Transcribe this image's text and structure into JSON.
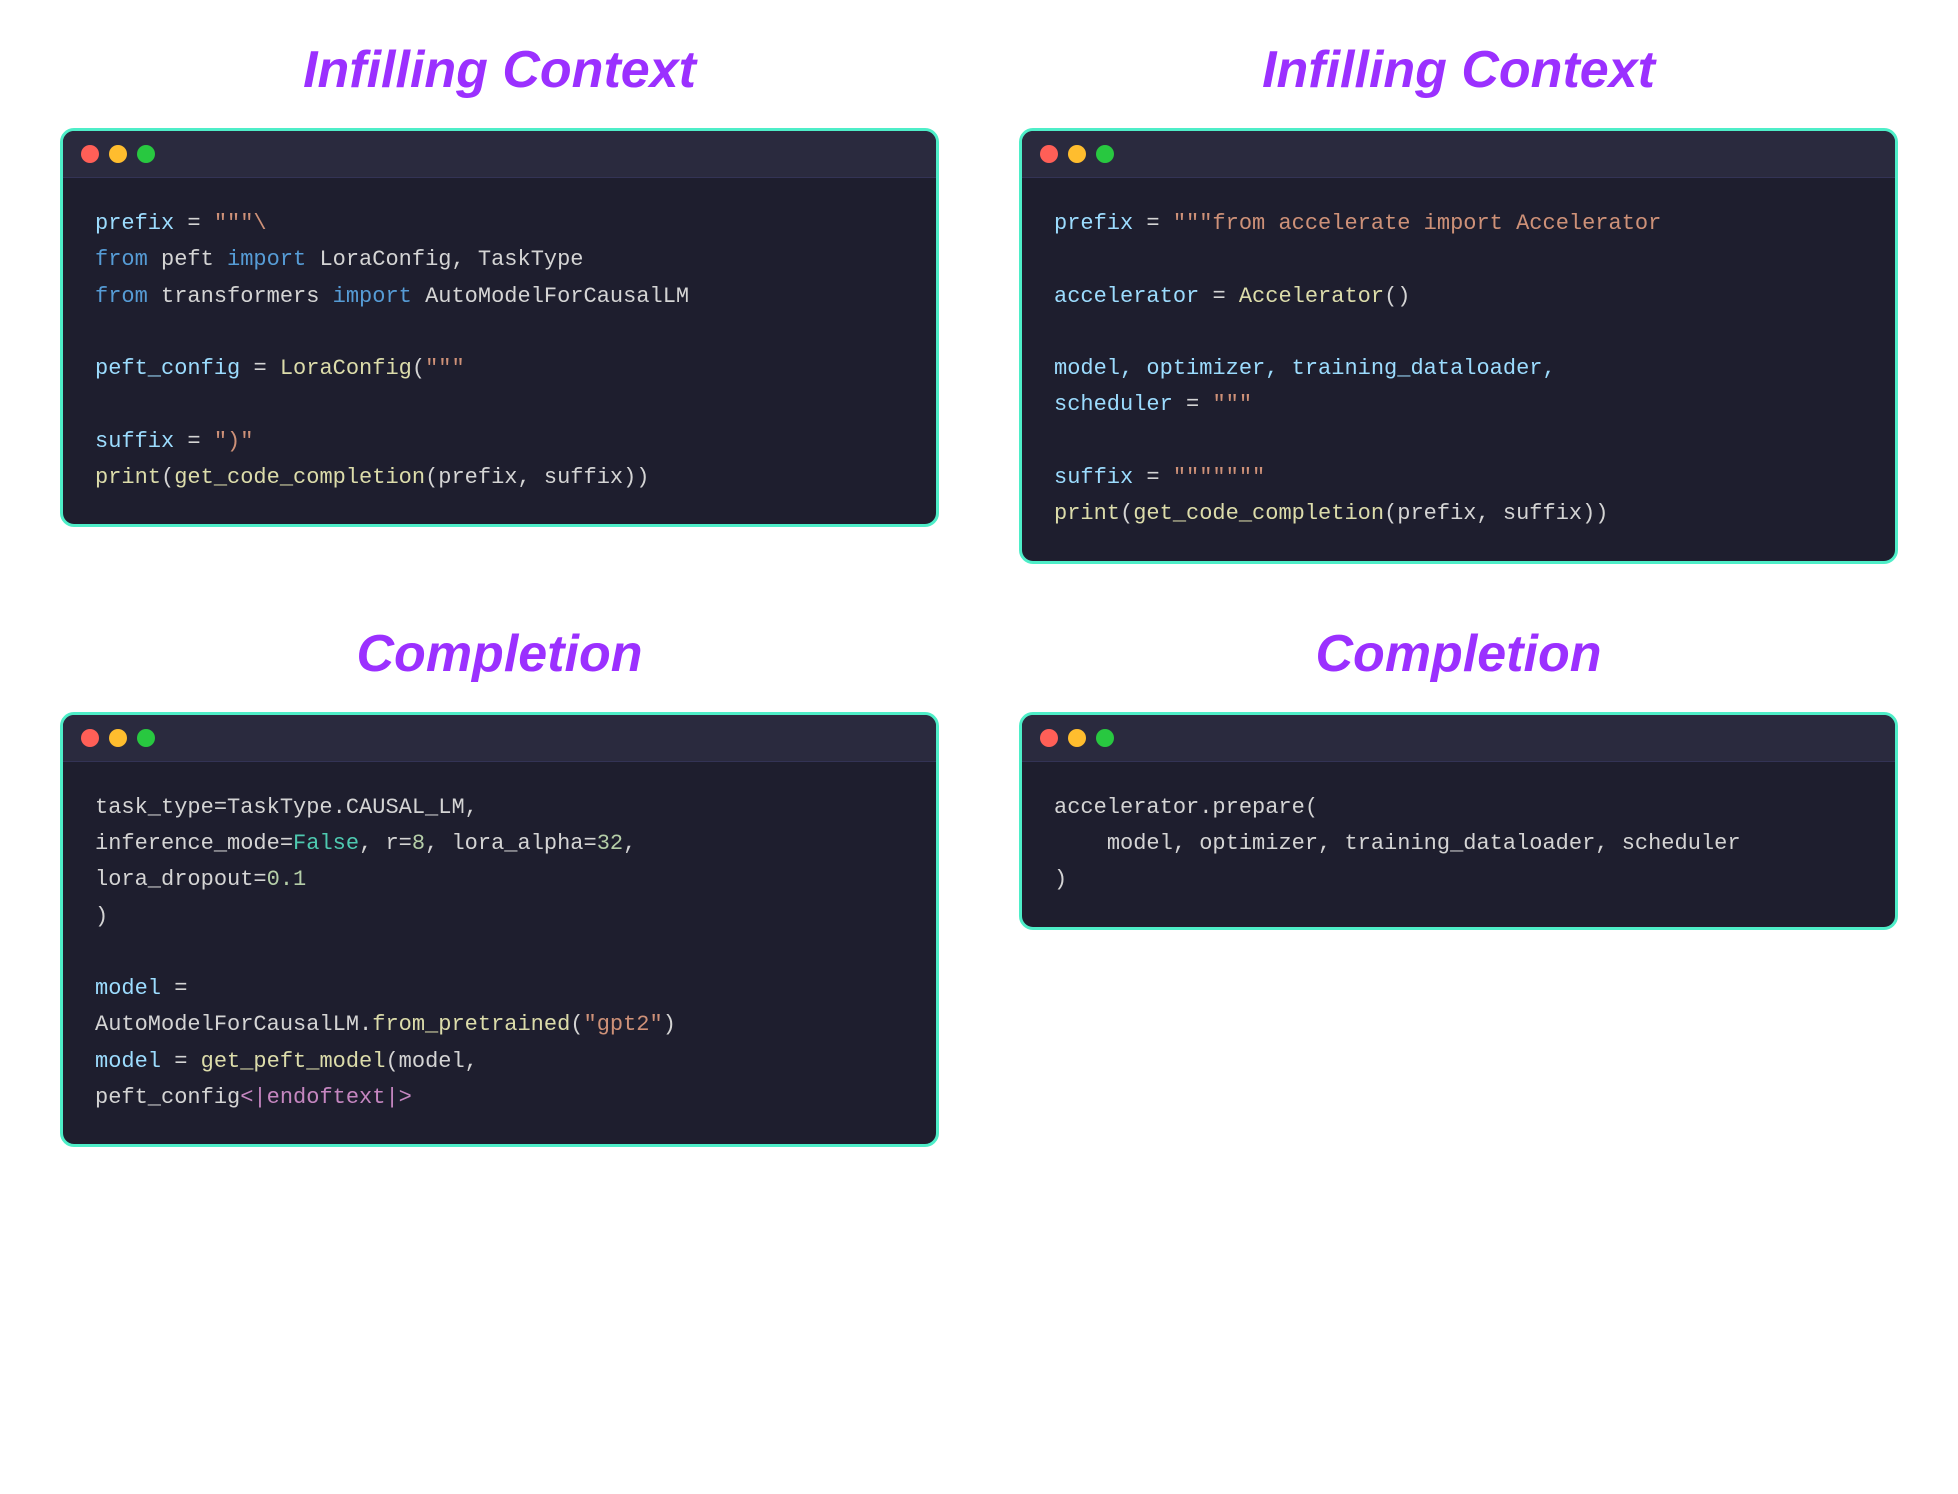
{
  "panels": [
    {
      "id": "top-left",
      "title": "Infilling Context",
      "codeLines": "top-left-code"
    },
    {
      "id": "top-right",
      "title": "Infilling Context",
      "codeLines": "top-right-code"
    },
    {
      "id": "bottom-left",
      "title": "Completion",
      "codeLines": "bottom-left-code"
    },
    {
      "id": "bottom-right",
      "title": "Completion",
      "codeLines": "bottom-right-code"
    }
  ]
}
